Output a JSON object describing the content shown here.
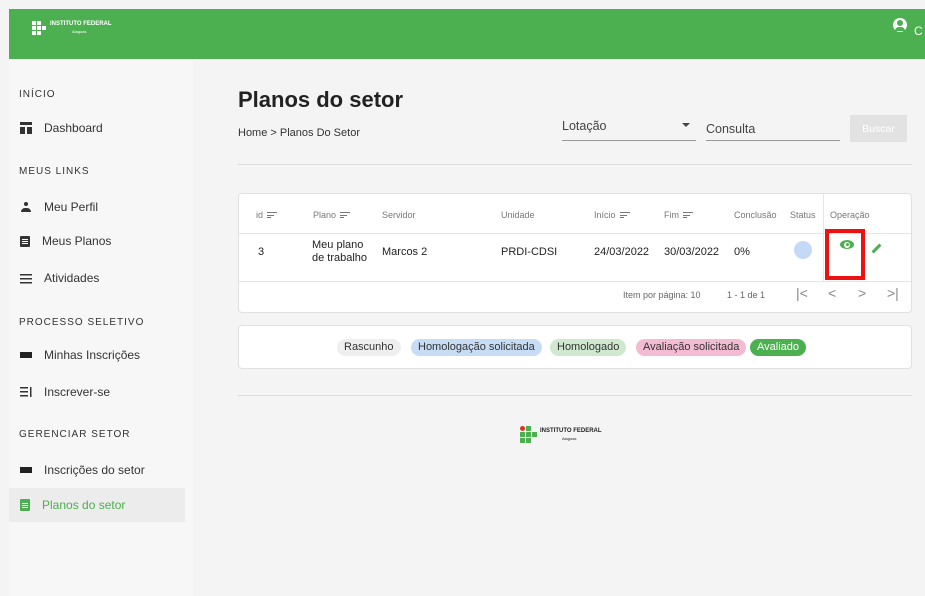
{
  "header": {
    "logo_text": "INSTITUTO FEDERAL",
    "logo_subtext": "Alagoas",
    "user_initial": "C"
  },
  "sidebar": {
    "sections": [
      {
        "title": "INÍCIO",
        "items": [
          {
            "label": "Dashboard",
            "icon": "dashboard-icon"
          }
        ]
      },
      {
        "title": "MEUS LINKS",
        "items": [
          {
            "label": "Meu Perfil",
            "icon": "person-icon"
          },
          {
            "label": "Meus Planos",
            "icon": "plan-icon"
          },
          {
            "label": "Atividades",
            "icon": "list-icon"
          }
        ]
      },
      {
        "title": "PROCESSO SELETIVO",
        "items": [
          {
            "label": "Minhas Inscrições",
            "icon": "bar-icon"
          },
          {
            "label": "Inscrever-se",
            "icon": "subscribe-icon"
          }
        ]
      },
      {
        "title": "GERENCIAR SETOR",
        "items": [
          {
            "label": "Inscrições do setor",
            "icon": "bar-icon"
          },
          {
            "label": "Planos do setor",
            "icon": "clipboard-icon",
            "active": true
          }
        ]
      }
    ]
  },
  "main": {
    "title": "Planos do setor",
    "breadcrumb": "Home > Planos Do Setor",
    "filter": {
      "lotacao_label": "Lotação",
      "consulta_placeholder": "Consulta",
      "buscar_label": "Buscar"
    },
    "table": {
      "headers": [
        "id",
        "Plano",
        "Servidor",
        "Unidade",
        "Início",
        "Fim",
        "Conclusão",
        "Status",
        "Operação"
      ],
      "rows": [
        {
          "id": "3",
          "plano_line1": "Meu plano",
          "plano_line2": "de trabalho",
          "servidor": "Marcos 2",
          "unidade": "PRDI-CDSI",
          "inicio": "24/03/2022",
          "fim": "30/03/2022",
          "conclusao": "0%",
          "status_color": "#c3d9f5"
        }
      ],
      "pager": {
        "items_per_page_label": "Item por página: 10",
        "range_label": "1 - 1 de 1",
        "first": "|<",
        "prev": "<",
        "next": ">",
        "last": ">|"
      }
    },
    "legend": [
      {
        "label": "Rascunho",
        "bg": "#efefef",
        "fg": "#333"
      },
      {
        "label": "Homologação solicitada",
        "bg": "#c7ddf5",
        "fg": "#333"
      },
      {
        "label": "Homologado",
        "bg": "#cfe8cf",
        "fg": "#333"
      },
      {
        "label": "Avaliação solicitada",
        "bg": "#f3bcd2",
        "fg": "#333"
      },
      {
        "label": "Avaliado",
        "bg": "#4caf50",
        "fg": "#ffffff"
      }
    ],
    "footer": {
      "logo_text": "INSTITUTO FEDERAL",
      "logo_subtext": "Alagoas"
    }
  }
}
